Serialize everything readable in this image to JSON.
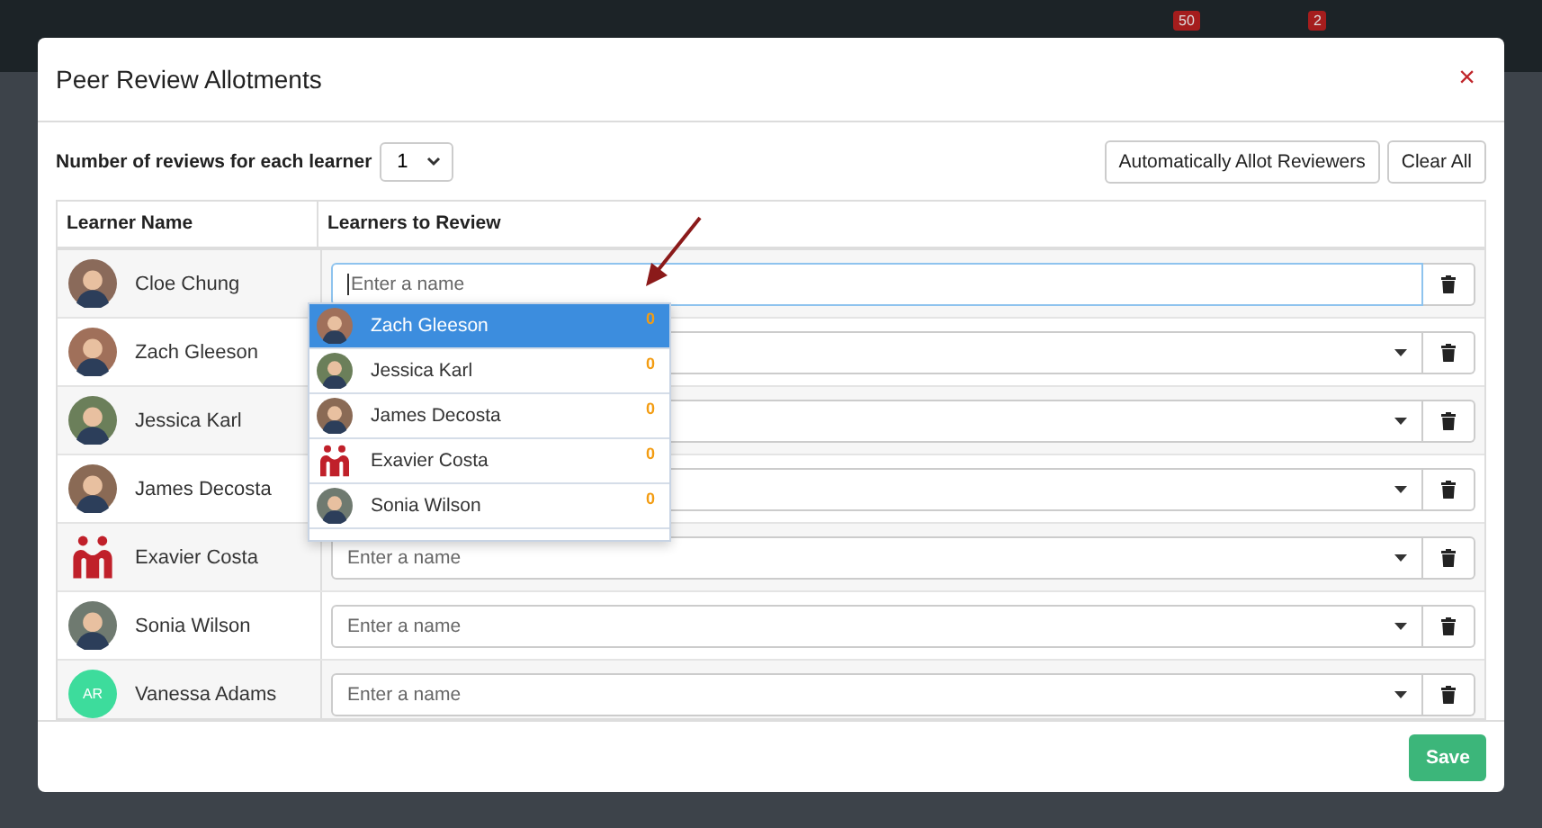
{
  "background": {
    "badges": [
      "50",
      "2"
    ]
  },
  "window": {
    "title": "Peer Review Allotments",
    "close": "×"
  },
  "reviews_per_learner": {
    "label": "Number of reviews for each learner",
    "value": "1"
  },
  "buttons": [
    "Automatically Allot Reviewers",
    "Clear All"
  ],
  "table": {
    "columns": [
      "Learner Name",
      "Learners to Review"
    ],
    "rows": [
      {
        "name": "Cloe Chung",
        "kind": "photo",
        "color": "#8a6a5a",
        "placeholder": "Enter a name",
        "focused": true
      },
      {
        "name": "Zach Gleeson",
        "kind": "photo",
        "color": "#a0705a",
        "focused": false
      },
      {
        "name": "Jessica Karl",
        "kind": "photo",
        "color": "#6b7f5a",
        "focused": false
      },
      {
        "name": "James Decosta",
        "kind": "photo",
        "color": "#8a6a55",
        "focused": false
      },
      {
        "name": "Exavier Costa",
        "kind": "logo",
        "color": "#c0202a",
        "placeholder": "Enter a name",
        "focused": false
      },
      {
        "name": "Sonia Wilson",
        "kind": "photo",
        "color": "#6f7a70",
        "placeholder": "Enter a name",
        "focused": false
      },
      {
        "name": "Vanessa Adams",
        "kind": "initials",
        "initials": "AR",
        "color": "#3ddc9c",
        "placeholder": "Enter a name",
        "focused": false
      }
    ]
  },
  "dropdown": {
    "options": [
      {
        "name": "Zach Gleeson",
        "kind": "photo",
        "color": "#a0705a",
        "count": "0",
        "selected": true
      },
      {
        "name": "Jessica Karl",
        "kind": "photo",
        "color": "#6b7f5a",
        "count": "0",
        "selected": false
      },
      {
        "name": "James Decosta",
        "kind": "photo",
        "color": "#8a6a55",
        "count": "0",
        "selected": false
      },
      {
        "name": "Exavier Costa",
        "kind": "logo",
        "color": "#c0202a",
        "count": "0",
        "selected": false
      },
      {
        "name": "Sonia Wilson",
        "kind": "photo",
        "color": "#6f7a70",
        "count": "0",
        "selected": false
      }
    ]
  },
  "save": "Save"
}
